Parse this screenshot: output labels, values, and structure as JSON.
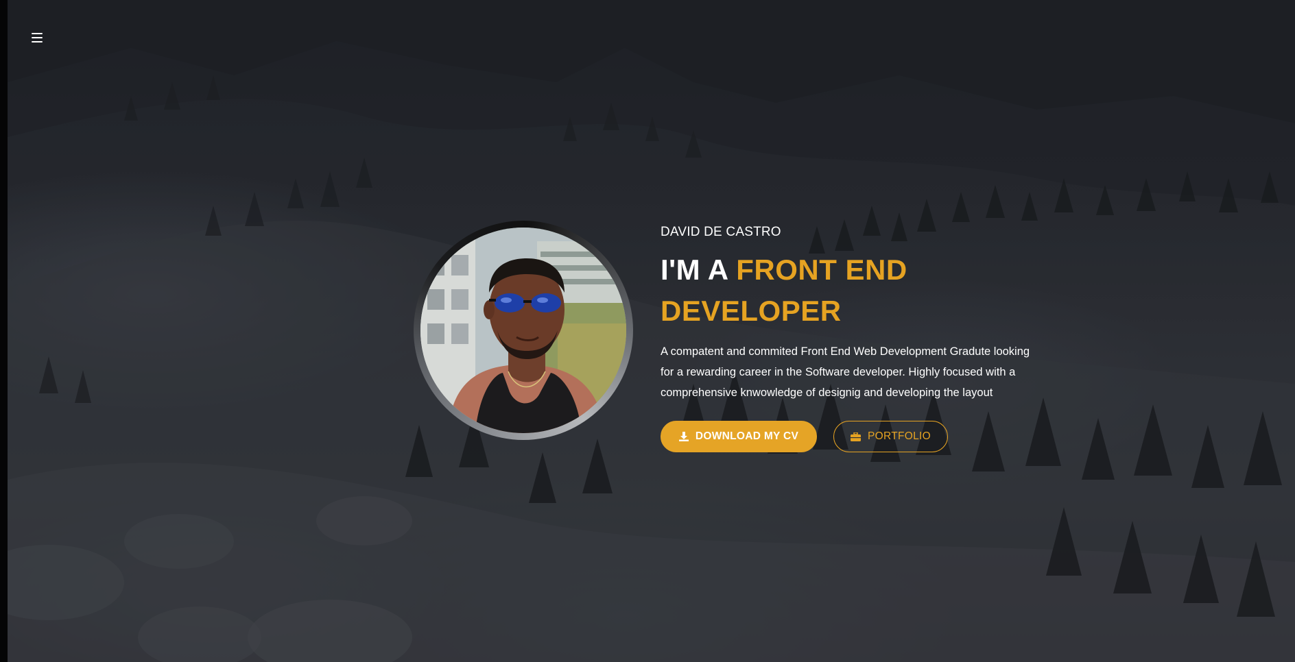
{
  "nav": {
    "menu_icon": "hamburger-menu-icon"
  },
  "profile": {
    "photo_alt": "Profile photo of David de Castro"
  },
  "hero": {
    "name": "DAVID DE CASTRO",
    "title_prefix": "I'M A ",
    "title_accent": "FRONT END DEVELOPER",
    "description": "A compatent and commited Front End Web Development Gradute looking for a rewarding career in the Software developer. Highly focused with a comprehensive knwowledge of designig and developing the layout",
    "buttons": {
      "download_label": "DOWNLOAD MY CV",
      "download_icon": "download-icon",
      "portfolio_label": "PORTFOLIO",
      "portfolio_icon": "briefcase-icon"
    }
  },
  "colors": {
    "accent": "#e5a426",
    "text": "#ffffff",
    "background": "#2b2e34"
  }
}
